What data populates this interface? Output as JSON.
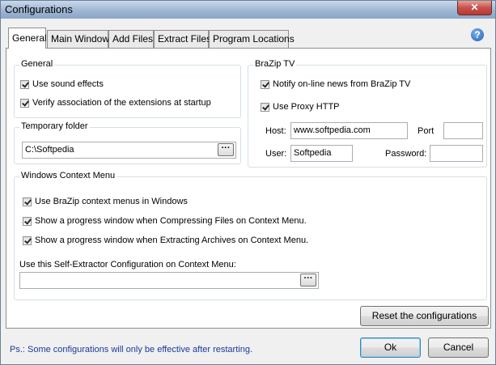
{
  "window": {
    "title": "Configurations",
    "close_glyph": "✕"
  },
  "help_icon": "?",
  "tabs": [
    {
      "label": "General",
      "active": true
    },
    {
      "label": "Main Window"
    },
    {
      "label": "Add Files"
    },
    {
      "label": "Extract Files"
    },
    {
      "label": "Program Locations"
    }
  ],
  "general": {
    "title": "General",
    "use_sound": "Use sound effects",
    "verify_assoc": "Verify association of the extensions at startup"
  },
  "temp_folder": {
    "title": "Temporary folder",
    "value": "C:\\Softpedia",
    "browse": "···"
  },
  "brazip_tv": {
    "title": "BraZip TV",
    "notify": "Notify on-line news from BraZip TV",
    "use_proxy": "Use Proxy HTTP",
    "host_label": "Host:",
    "host_value": "www.softpedia.com",
    "port_label": "Port",
    "port_value": "",
    "user_label": "User:",
    "user_value": "Softpedia",
    "password_label": "Password:",
    "password_value": ""
  },
  "context_menu": {
    "title": "Windows Context Menu",
    "use_brazip": "Use BraZip context menus in Windows",
    "progress_compress": "Show a progress window when Compressing Files on Context Menu.",
    "progress_extract": "Show a progress window when Extracting Archives on Context Menu.",
    "sfx_label": "Use this Self-Extractor Configuration on Context Menu:",
    "sfx_value": "",
    "browse": "···"
  },
  "buttons": {
    "reset": "Reset the configurations",
    "ok": "Ok",
    "cancel": "Cancel"
  },
  "footer": {
    "note": "Ps.: Some configurations will only be effective after restarting."
  }
}
